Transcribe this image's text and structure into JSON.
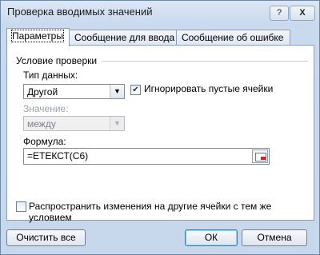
{
  "window": {
    "title": "Проверка вводимых значений",
    "help_label": "?",
    "close_label": "X"
  },
  "tabs": [
    {
      "label": "Параметры"
    },
    {
      "label": "Сообщение для ввода"
    },
    {
      "label": "Сообщение об ошибке"
    }
  ],
  "settings": {
    "group_title": "Условие проверки",
    "data_type_label": "Тип данных:",
    "data_type_value": "Другой",
    "ignore_blank_label": "Игнорировать пустые ячейки",
    "ignore_blank_checked": true,
    "value_label": "Значение:",
    "operator_value": "между",
    "formula_label": "Формула:",
    "formula_value": "=ЕТЕКСТ(C6)",
    "apply_all_label": "Распространить изменения на другие ячейки с тем же условием",
    "apply_all_checked": false
  },
  "buttons": {
    "clear_all": "Очистить все",
    "ok": "ОК",
    "cancel": "Отмена"
  },
  "icons": {
    "dropdown": "chevron-down-icon",
    "check": "checkmark-icon",
    "range_select": "range-select-icon"
  }
}
